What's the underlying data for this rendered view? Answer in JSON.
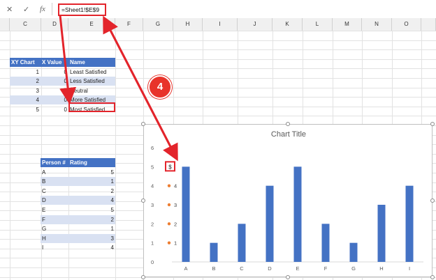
{
  "formula_bar": {
    "cancel_icon": "✕",
    "enter_icon": "✓",
    "fx_label": "fx",
    "formula": "=Sheet1!$E$9"
  },
  "columns": [
    "C",
    "D",
    "E",
    "F",
    "G",
    "H",
    "I",
    "J",
    "K",
    "L",
    "M",
    "N",
    "O"
  ],
  "xy_table": {
    "headers": [
      "XY Chart",
      "X Value",
      "Name"
    ],
    "rows": [
      [
        "1",
        "0",
        "Least Satisfied"
      ],
      [
        "2",
        "0",
        "Less Satisfied"
      ],
      [
        "3",
        "0",
        "Neutral"
      ],
      [
        "4",
        "0",
        "More Satisfied"
      ],
      [
        "5",
        "0",
        "Most Satisfied"
      ]
    ]
  },
  "rating_table": {
    "headers": [
      "Person #",
      "Rating"
    ],
    "rows": [
      [
        "A",
        "5"
      ],
      [
        "B",
        "1"
      ],
      [
        "C",
        "2"
      ],
      [
        "D",
        "4"
      ],
      [
        "E",
        "5"
      ],
      [
        "F",
        "2"
      ],
      [
        "G",
        "1"
      ],
      [
        "H",
        "3"
      ],
      [
        "I",
        "4"
      ]
    ]
  },
  "step_number": "4",
  "colors": {
    "accent_red": "#e3242b",
    "bar_blue": "#4472c4",
    "point_orange": "#ed7d31",
    "header_blue": "#4472c4",
    "band_blue": "#d9e1f2"
  },
  "chart_data": {
    "type": "bar",
    "title": "Chart Title",
    "categories": [
      "A",
      "B",
      "C",
      "D",
      "E",
      "F",
      "G",
      "H",
      "I"
    ],
    "values": [
      5,
      1,
      2,
      4,
      5,
      2,
      1,
      3,
      4
    ],
    "ylim": [
      0,
      6
    ],
    "yticks": [
      "0",
      "1",
      "2",
      "3",
      "4",
      "5",
      "6"
    ],
    "scatter_points": [
      {
        "x": 0,
        "y": 1,
        "label": "1"
      },
      {
        "x": 0,
        "y": 2,
        "label": "2"
      },
      {
        "x": 0,
        "y": 3,
        "label": "3"
      },
      {
        "x": 0,
        "y": 4,
        "label": "4"
      },
      {
        "x": 0,
        "y": 5,
        "label": "$"
      }
    ]
  }
}
